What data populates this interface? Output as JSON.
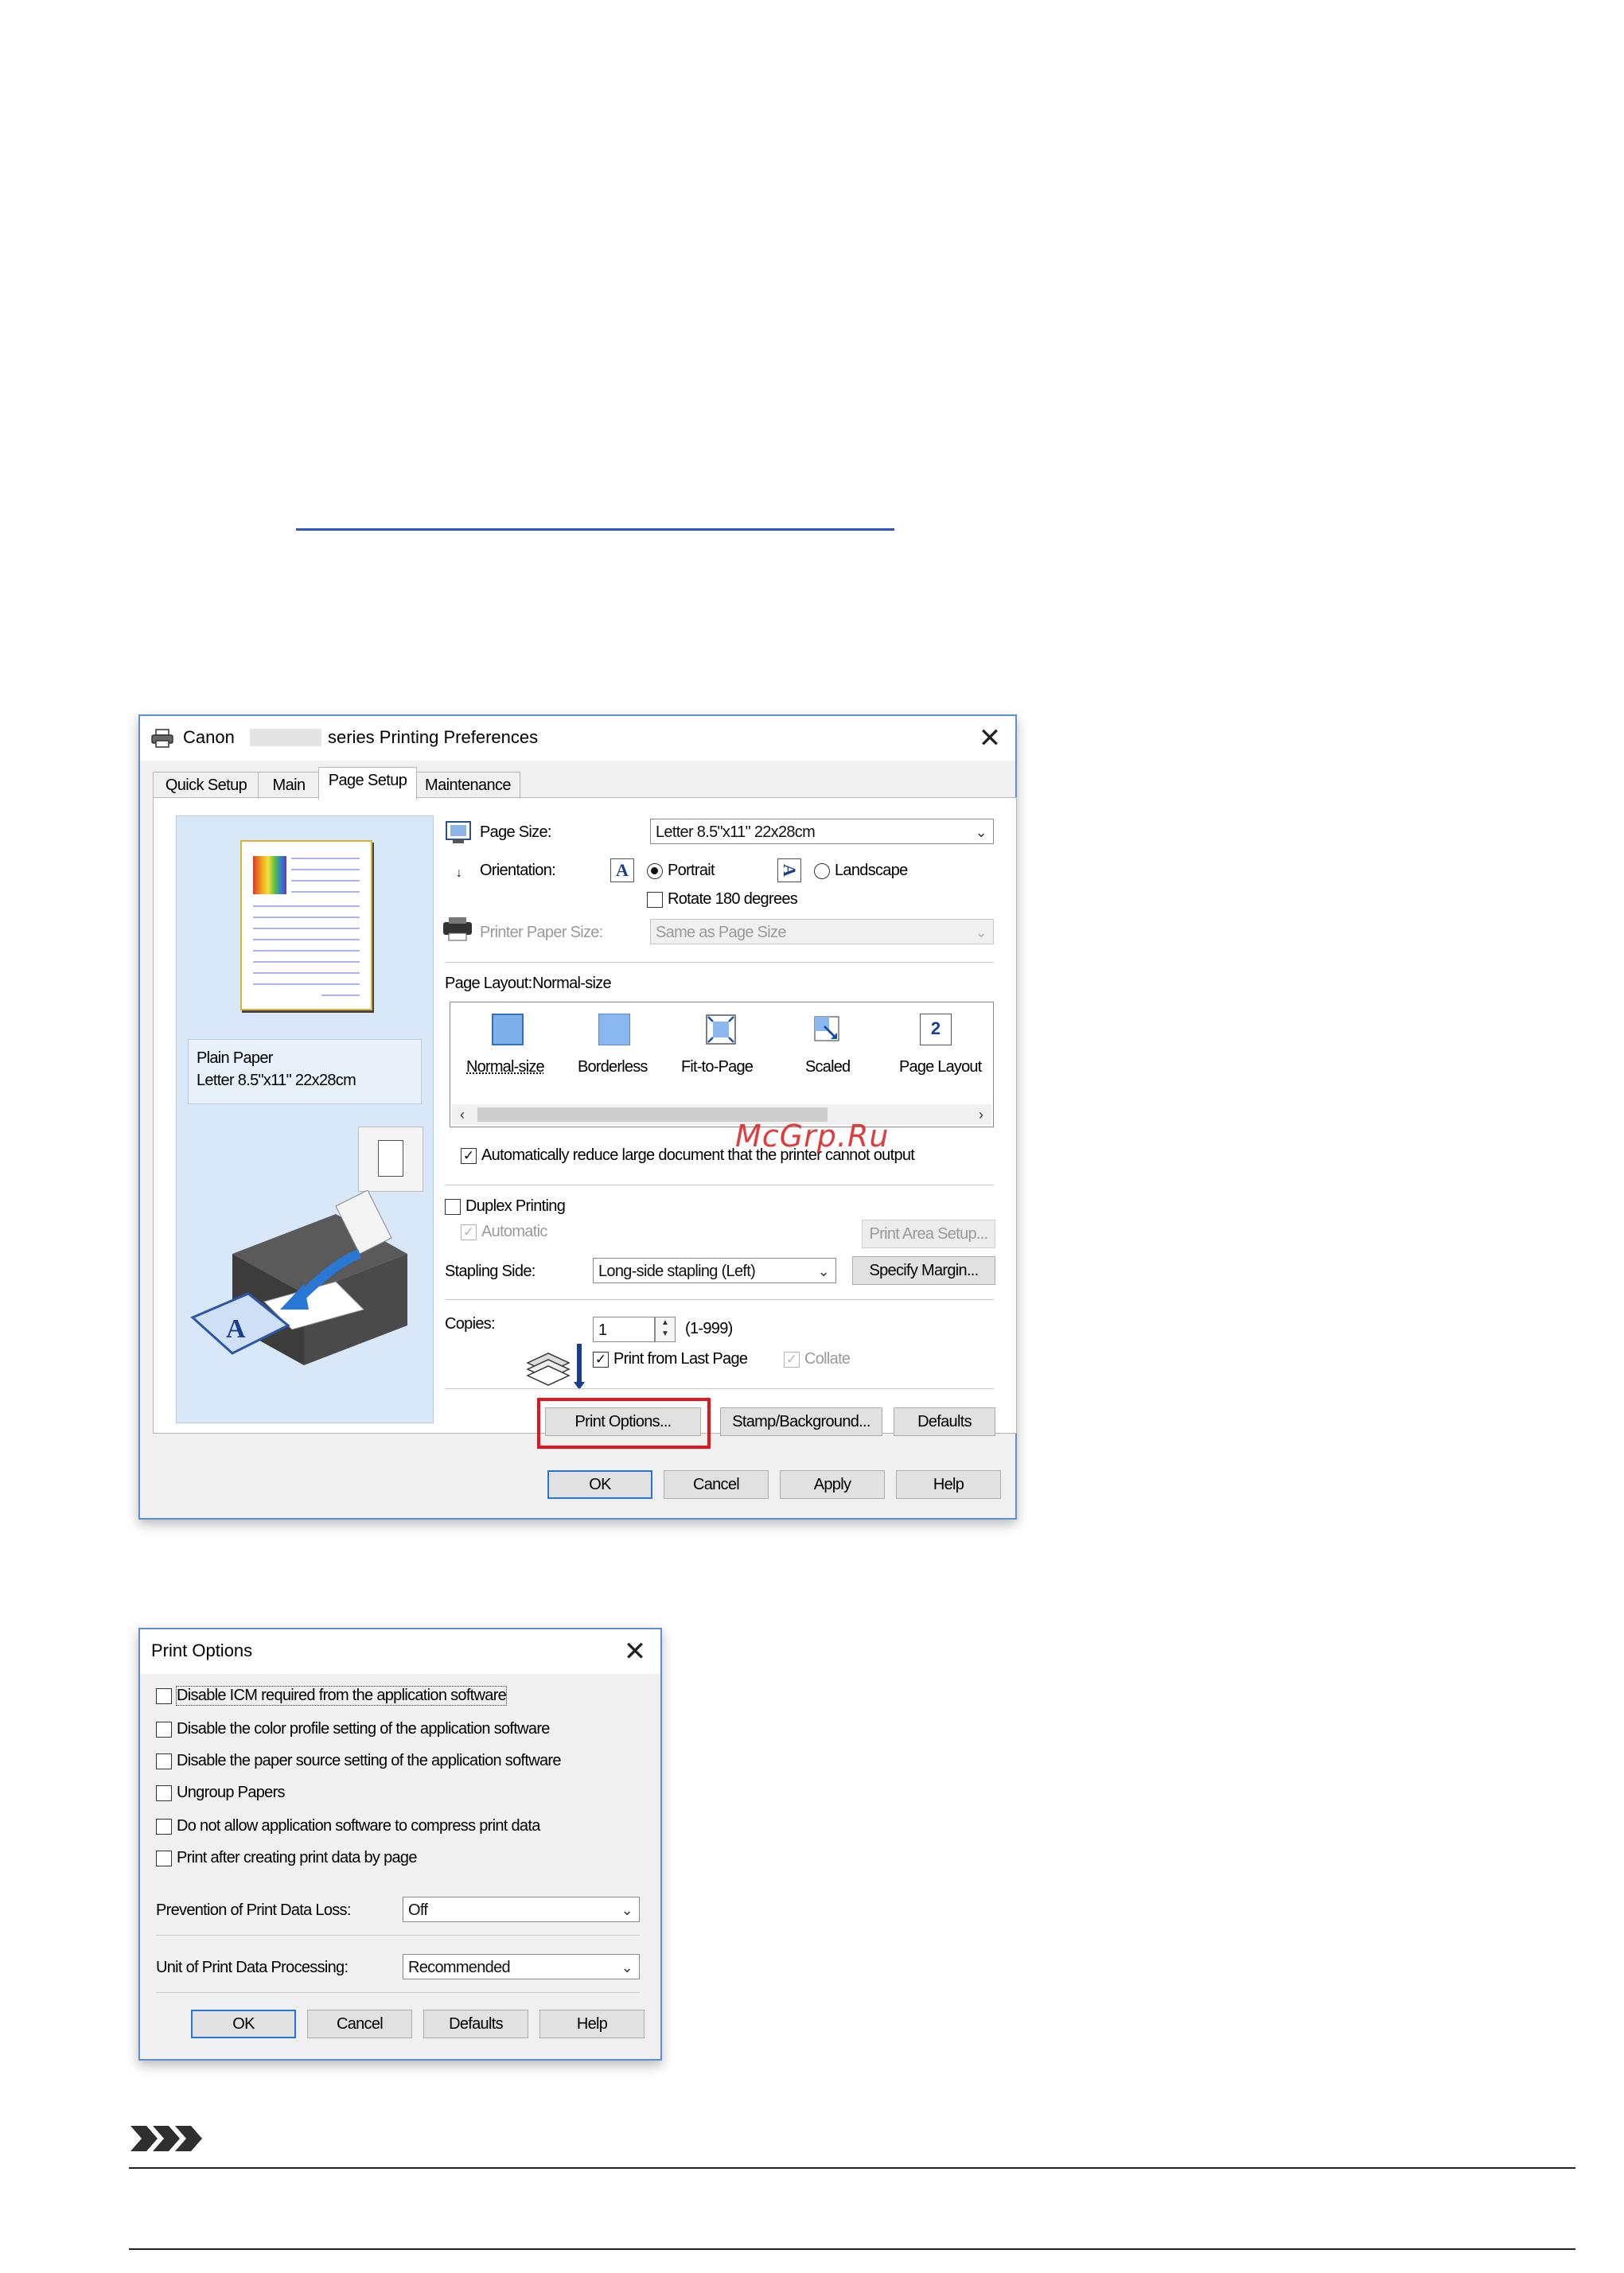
{
  "dialog_main": {
    "title_left": "Canon",
    "title_right": "series Printing Preferences",
    "close_symbol": "✕",
    "tabs": [
      "Quick Setup",
      "Main",
      "Page Setup",
      "Maintenance"
    ],
    "active_tab": "Page Setup",
    "preview": {
      "media_type": "Plain Paper",
      "paper_size": "Letter 8.5\"x11\" 22x28cm"
    },
    "page_size_label": "Page Size:",
    "page_size_value": "Letter 8.5\"x11\" 22x28cm",
    "orientation_label": "Orientation:",
    "orientation_options": [
      "Portrait",
      "Landscape"
    ],
    "orientation_selected": "Portrait",
    "orientation_glyph": "A",
    "rotate_label": "Rotate 180 degrees",
    "printer_paper_size_label": "Printer Paper Size:",
    "printer_paper_size_value": "Same as Page Size",
    "page_layout_label": "Page Layout:",
    "page_layout_value": "Normal-size",
    "layouts": [
      "Normal-size",
      "Borderless",
      "Fit-to-Page",
      "Scaled",
      "Page Layout"
    ],
    "layout_selected": "Normal-size",
    "page_layout_icon_number": "2",
    "scroll_left": "‹",
    "scroll_right": "›",
    "auto_reduce_label": "Automatically reduce large document that the printer cannot output",
    "auto_reduce_checked": true,
    "duplex_label": "Duplex Printing",
    "duplex_checked": false,
    "automatic_label": "Automatic",
    "automatic_checked": true,
    "print_area_setup_label": "Print Area Setup...",
    "stapling_side_label": "Stapling Side:",
    "stapling_side_value": "Long-side stapling (Left)",
    "specify_margin_label": "Specify Margin...",
    "copies_label": "Copies:",
    "copies_value": "1",
    "copies_range": "(1-999)",
    "print_from_last_page_label": "Print from Last Page",
    "print_from_last_page_checked": true,
    "collate_label": "Collate",
    "collate_checked": true,
    "print_options_button": "Print Options...",
    "stamp_background_button": "Stamp/Background...",
    "defaults_button": "Defaults",
    "ok_button": "OK",
    "cancel_button": "Cancel",
    "apply_button": "Apply",
    "help_button": "Help",
    "check_mark": "✓",
    "combo_arrow": "⌄",
    "spin_up": "▲",
    "spin_down": "▼"
  },
  "watermark": "McGrp.Ru",
  "dialog_print_options": {
    "title": "Print Options",
    "close_symbol": "✕",
    "checkboxes": [
      {
        "label": "Disable ICM required from the application software",
        "checked": false
      },
      {
        "label": "Disable the color profile setting of the application software",
        "checked": false
      },
      {
        "label": "Disable the paper source setting of the application software",
        "checked": false
      },
      {
        "label": "Ungroup Papers",
        "checked": false
      },
      {
        "label": "Do not allow application software to compress print data",
        "checked": false
      },
      {
        "label": "Print after creating print data by page",
        "checked": false
      }
    ],
    "prevention_label": "Prevention of Print Data Loss:",
    "prevention_value": "Off",
    "unit_label": "Unit of Print Data Processing:",
    "unit_value": "Recommended",
    "ok_button": "OK",
    "cancel_button": "Cancel",
    "defaults_button": "Defaults",
    "help_button": "Help"
  },
  "colors": {
    "highlight_red": "#e8141d",
    "link_blue": "#2c57c6",
    "window_border": "#5d8fd3",
    "preview_bg": "#d8e8f8"
  }
}
